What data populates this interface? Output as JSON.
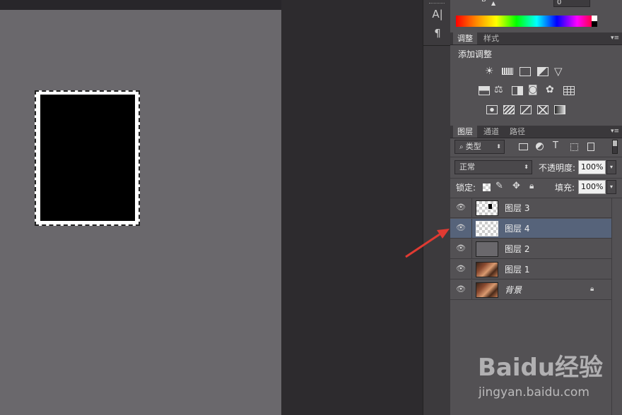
{
  "toolbar": {
    "type_tool": "A|",
    "para_tool": "¶"
  },
  "color_panel": {
    "b_label": "B",
    "b_value": "0"
  },
  "adjustments": {
    "tabs": [
      "调整",
      "样式"
    ],
    "title": "添加调整"
  },
  "layers_panel": {
    "tabs": [
      "图层",
      "通道",
      "路径"
    ],
    "filter_kind": "类型",
    "blend_mode": "正常",
    "opacity_label": "不透明度:",
    "opacity_value": "100%",
    "lock_label": "锁定:",
    "fill_label": "填充:",
    "fill_value": "100%",
    "layers": [
      {
        "name": "图层 3",
        "selected": false
      },
      {
        "name": "图层 4",
        "selected": true
      },
      {
        "name": "图层 2",
        "selected": false
      },
      {
        "name": "图层 1",
        "selected": false
      },
      {
        "name": "背景",
        "selected": false,
        "locked": true
      }
    ]
  },
  "watermark": {
    "logo": "Baidu经验",
    "url": "jingyan.baidu.com"
  },
  "colors": {
    "panel_bg": "#535154",
    "selected_layer": "#56637a",
    "arrow": "#e03a32"
  }
}
